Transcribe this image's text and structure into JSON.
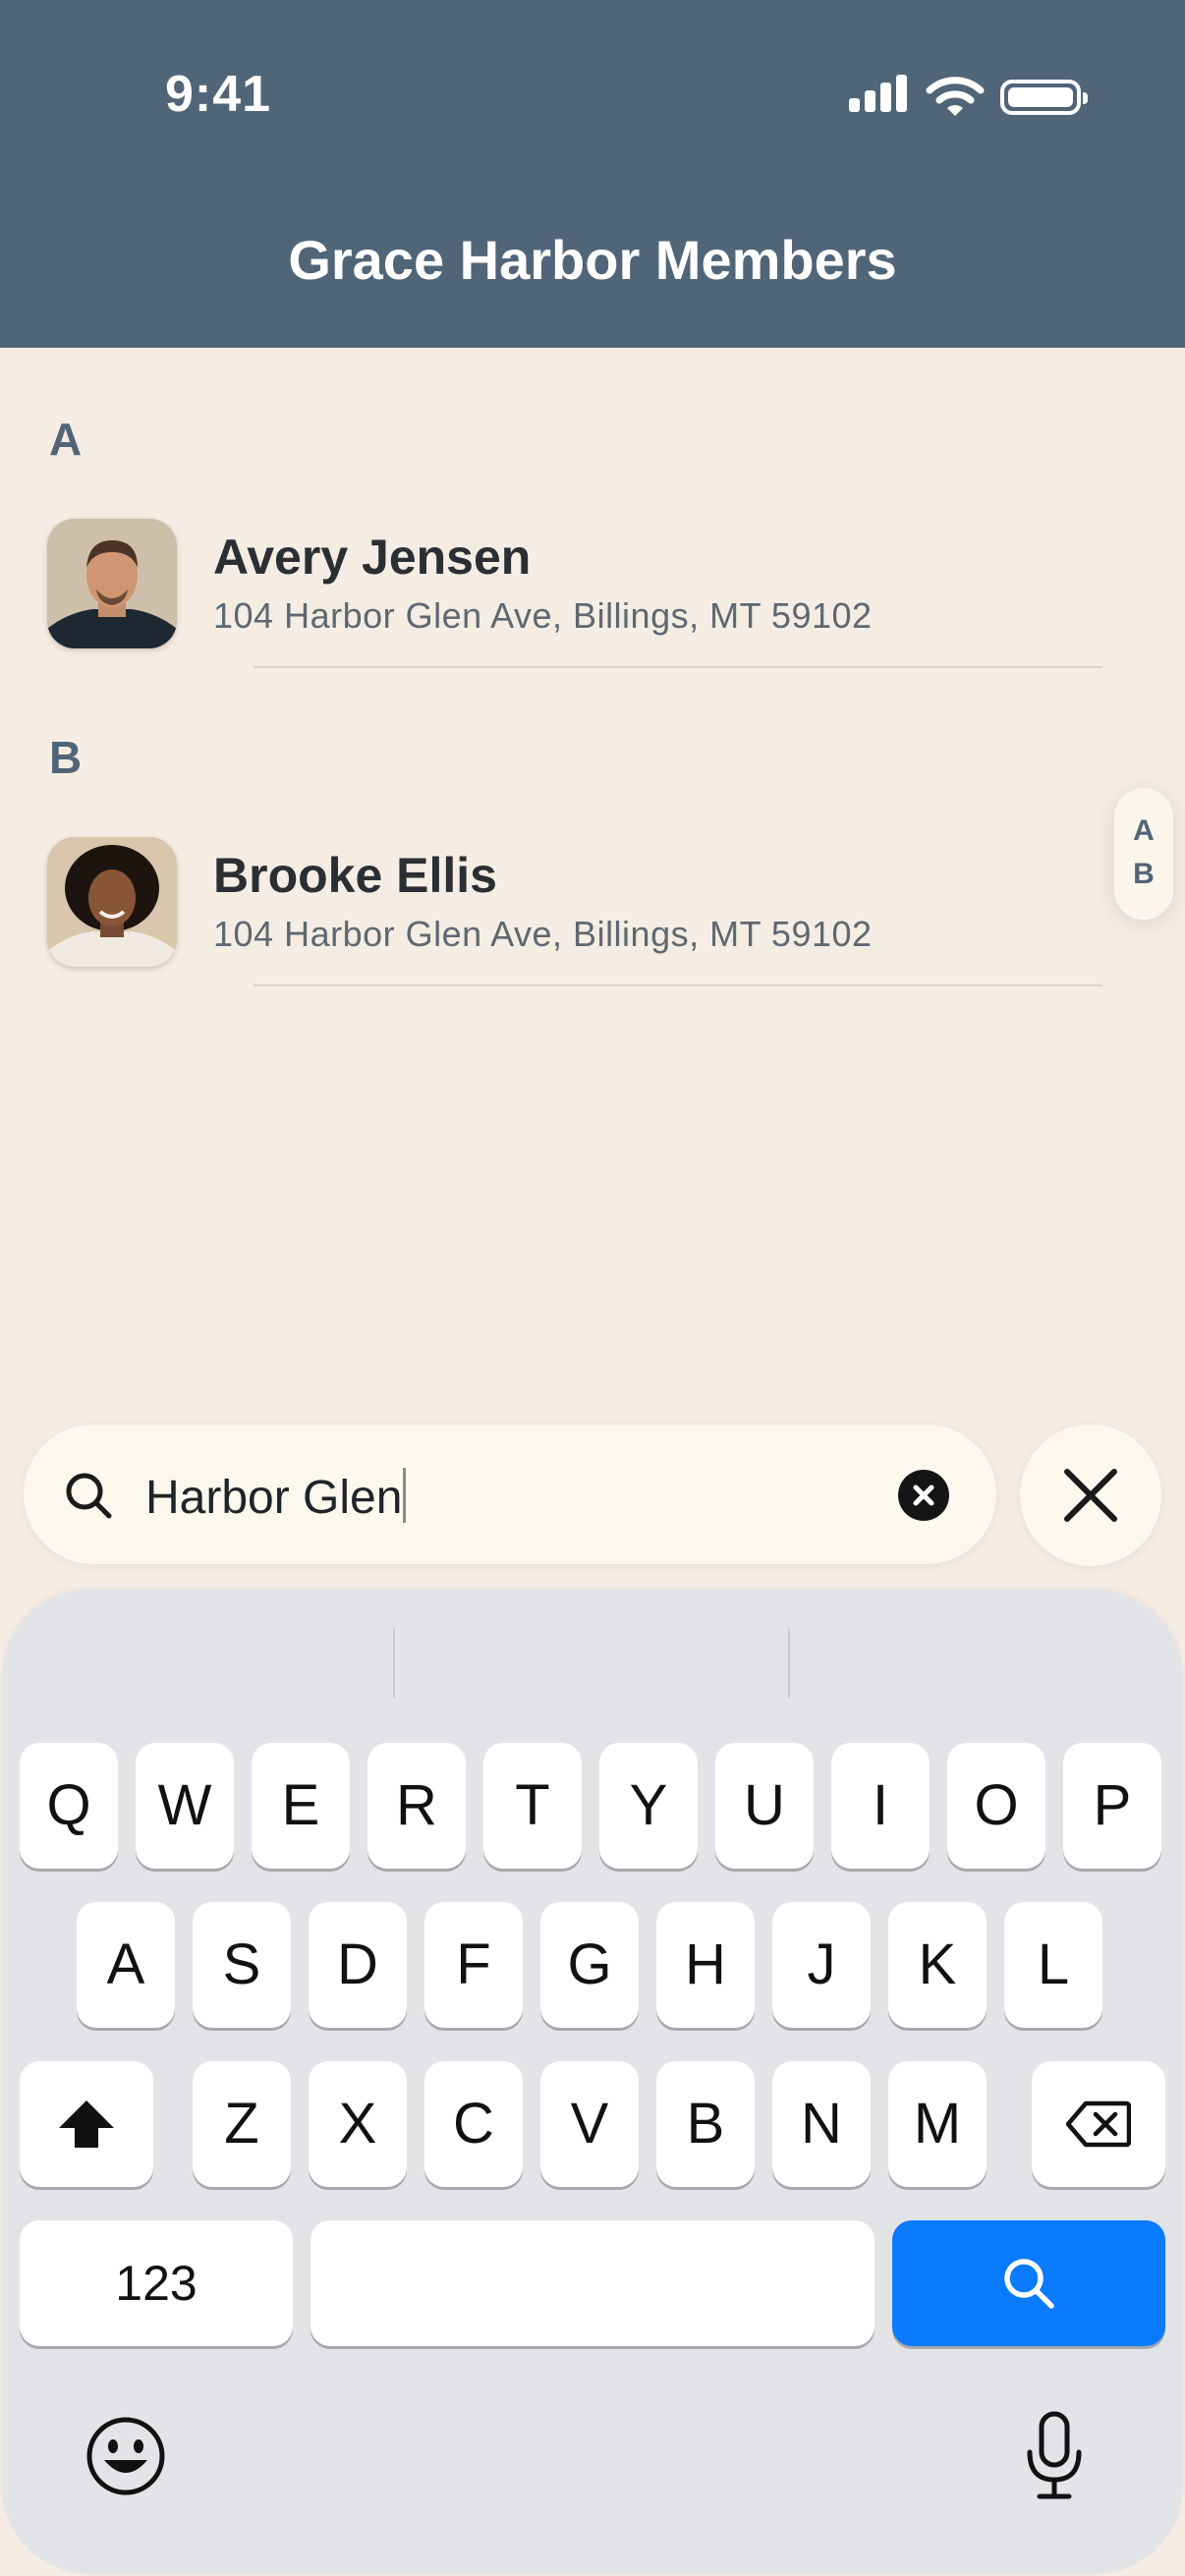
{
  "status_bar": {
    "time": "9:41"
  },
  "header": {
    "title": "Grace Harbor Members"
  },
  "sections": [
    {
      "letter": "A",
      "members": [
        {
          "name": "Avery Jensen",
          "address": "104 Harbor Glen Ave, Billings, MT 59102"
        }
      ]
    },
    {
      "letter": "B",
      "members": [
        {
          "name": "Brooke Ellis",
          "address": "104 Harbor Glen Ave, Billings, MT 59102"
        }
      ]
    }
  ],
  "index_bar": [
    "A",
    "B"
  ],
  "search": {
    "value": "Harbor Glen"
  },
  "keyboard": {
    "row1": [
      "Q",
      "W",
      "E",
      "R",
      "T",
      "Y",
      "U",
      "I",
      "O",
      "P"
    ],
    "row2": [
      "A",
      "S",
      "D",
      "F",
      "G",
      "H",
      "J",
      "K",
      "L"
    ],
    "row3": [
      "Z",
      "X",
      "C",
      "V",
      "B",
      "N",
      "M"
    ],
    "numbers_label": "123"
  },
  "colors": {
    "header": "#516578",
    "background": "#f5ede3",
    "search_key": "#0a7aff"
  }
}
